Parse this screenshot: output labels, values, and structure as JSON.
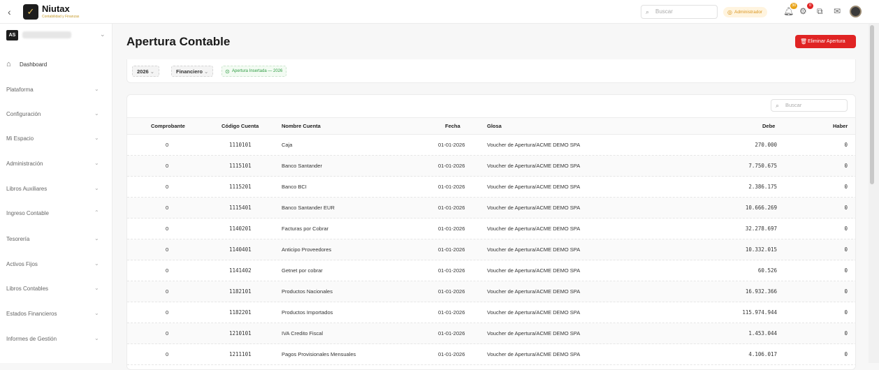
{
  "app": {
    "name": "Niutax",
    "tagline": "Contabilidad y Finanzas"
  },
  "topbar": {
    "back_icon": "chevron-left-icon",
    "search_placeholder": "Buscar",
    "role": "Administrador",
    "bell_badge": "30",
    "gear_badge": "0"
  },
  "sidebar": {
    "workspace_initials": "AS",
    "items": [
      {
        "label": "Dashboard",
        "icon": "home-icon"
      },
      {
        "label": "Plataforma"
      },
      {
        "label": "Configuración"
      },
      {
        "label": "Mi Espacio"
      },
      {
        "label": "Administración"
      },
      {
        "label": "Libros Auxiliares"
      },
      {
        "label": "Ingreso Contable",
        "expanded": true
      },
      {
        "label": "Tesorería"
      },
      {
        "label": "Activos Fijos"
      },
      {
        "label": "Libros Contables"
      },
      {
        "label": "Estados Financieros"
      },
      {
        "label": "Informes de Gestión"
      }
    ]
  },
  "page": {
    "title": "Apertura Contable",
    "delete_button": "Eliminar Apertura"
  },
  "filters": {
    "year": "2026",
    "type": "Financiero",
    "status": "Apertura Insertada — 2026"
  },
  "table": {
    "search_placeholder": "Buscar",
    "columns": [
      "Comprobante",
      "Código Cuenta",
      "Nombre Cuenta",
      "Fecha",
      "Glosa",
      "Debe",
      "Haber"
    ],
    "rows": [
      {
        "comprobante": "0",
        "codigo": "1110101",
        "nombre": "Caja",
        "fecha": "01-01-2026",
        "glosa": "Voucher de Apertura/ACME DEMO SPA",
        "debe": "270.000",
        "haber": "0"
      },
      {
        "comprobante": "0",
        "codigo": "1115101",
        "nombre": "Banco Santander",
        "fecha": "01-01-2026",
        "glosa": "Voucher de Apertura/ACME DEMO SPA",
        "debe": "7.750.675",
        "haber": "0"
      },
      {
        "comprobante": "0",
        "codigo": "1115201",
        "nombre": "Banco BCI",
        "fecha": "01-01-2026",
        "glosa": "Voucher de Apertura/ACME DEMO SPA",
        "debe": "2.386.175",
        "haber": "0"
      },
      {
        "comprobante": "0",
        "codigo": "1115401",
        "nombre": "Banco Santander EUR",
        "fecha": "01-01-2026",
        "glosa": "Voucher de Apertura/ACME DEMO SPA",
        "debe": "10.666.269",
        "haber": "0"
      },
      {
        "comprobante": "0",
        "codigo": "1140201",
        "nombre": "Facturas por Cobrar",
        "fecha": "01-01-2026",
        "glosa": "Voucher de Apertura/ACME DEMO SPA",
        "debe": "32.278.697",
        "haber": "0"
      },
      {
        "comprobante": "0",
        "codigo": "1140401",
        "nombre": "Anticipo Proveedores",
        "fecha": "01-01-2026",
        "glosa": "Voucher de Apertura/ACME DEMO SPA",
        "debe": "10.332.015",
        "haber": "0"
      },
      {
        "comprobante": "0",
        "codigo": "1141402",
        "nombre": "Getnet por cobrar",
        "fecha": "01-01-2026",
        "glosa": "Voucher de Apertura/ACME DEMO SPA",
        "debe": "60.526",
        "haber": "0"
      },
      {
        "comprobante": "0",
        "codigo": "1182101",
        "nombre": "Productos Nacionales",
        "fecha": "01-01-2026",
        "glosa": "Voucher de Apertura/ACME DEMO SPA",
        "debe": "16.932.366",
        "haber": "0"
      },
      {
        "comprobante": "0",
        "codigo": "1182201",
        "nombre": "Productos Importados",
        "fecha": "01-01-2026",
        "glosa": "Voucher de Apertura/ACME DEMO SPA",
        "debe": "115.974.944",
        "haber": "0"
      },
      {
        "comprobante": "0",
        "codigo": "1210101",
        "nombre": "IVA Credito Fiscal",
        "fecha": "01-01-2026",
        "glosa": "Voucher de Apertura/ACME DEMO SPA",
        "debe": "1.453.044",
        "haber": "0"
      },
      {
        "comprobante": "0",
        "codigo": "1211101",
        "nombre": "Pagos Provisionales Mensuales",
        "fecha": "01-01-2026",
        "glosa": "Voucher de Apertura/ACME DEMO SPA",
        "debe": "4.106.017",
        "haber": "0"
      }
    ]
  },
  "colors": {
    "accent": "#e02424",
    "brand_gold": "#c69b2c",
    "success": "#2f9d43",
    "role_pill": "#d9951f"
  }
}
